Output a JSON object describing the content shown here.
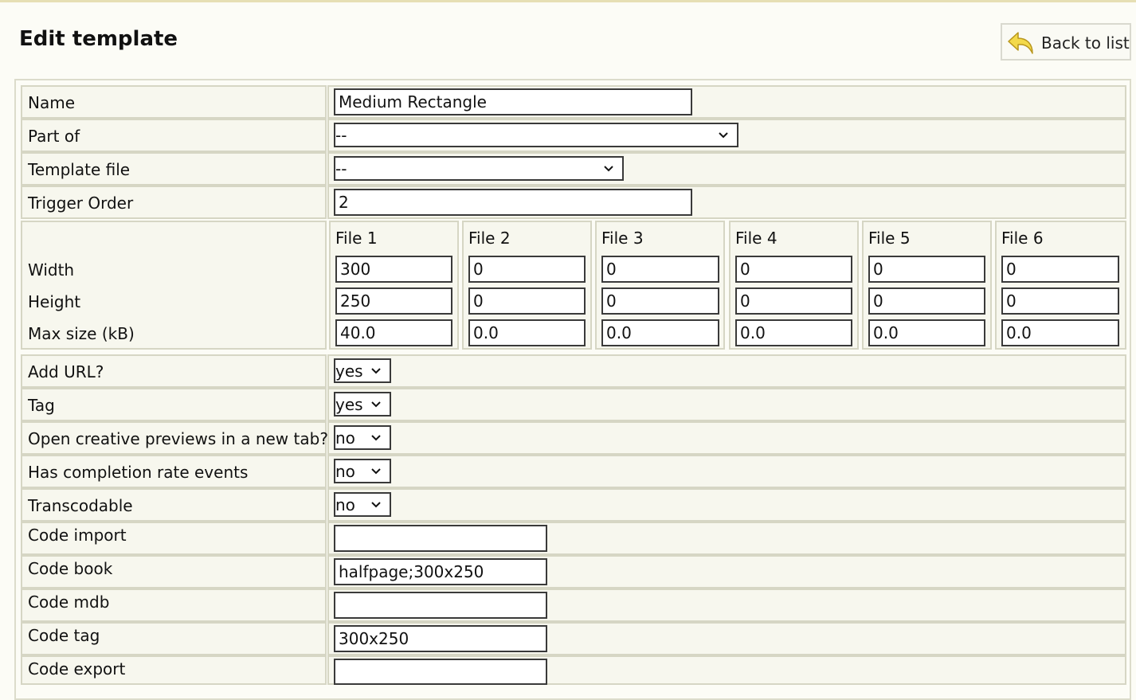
{
  "header": {
    "title": "Edit template",
    "back_label": "Back to list"
  },
  "form": {
    "name": {
      "label": "Name",
      "value": "Medium Rectangle"
    },
    "part_of": {
      "label": "Part of",
      "value": "--"
    },
    "template_file": {
      "label": "Template file",
      "value": "--"
    },
    "trigger_order": {
      "label": "Trigger Order",
      "value": "2"
    },
    "files": {
      "headers": [
        "File 1",
        "File 2",
        "File 3",
        "File 4",
        "File 5",
        "File 6"
      ],
      "rows": [
        {
          "label": "Width",
          "values": [
            "300",
            "0",
            "0",
            "0",
            "0",
            "0"
          ]
        },
        {
          "label": "Height",
          "values": [
            "250",
            "0",
            "0",
            "0",
            "0",
            "0"
          ]
        },
        {
          "label": "Max size (kB)",
          "values": [
            "40.0",
            "0.0",
            "0.0",
            "0.0",
            "0.0",
            "0.0"
          ]
        }
      ]
    },
    "add_url": {
      "label": "Add URL?",
      "value": "yes"
    },
    "tag": {
      "label": "Tag",
      "value": "yes"
    },
    "open_previews": {
      "label": "Open creative previews in a new tab?",
      "value": "no"
    },
    "completion_events": {
      "label": "Has completion rate events",
      "value": "no"
    },
    "transcodable": {
      "label": "Transcodable",
      "value": "no"
    },
    "code_import": {
      "label": "Code import",
      "value": ""
    },
    "code_book": {
      "label": "Code book",
      "value": "halfpage;300x250"
    },
    "code_mdb": {
      "label": "Code mdb",
      "value": ""
    },
    "code_tag": {
      "label": "Code tag",
      "value": "300x250"
    },
    "code_export": {
      "label": "Code export",
      "value": ""
    }
  },
  "icons": {
    "back": "undo-arrow-icon",
    "dropdown": "chevron-down-icon"
  },
  "colors": {
    "background": "#fcfcf6",
    "cell": "#f7f7ee",
    "icon": "#f3d94a"
  }
}
